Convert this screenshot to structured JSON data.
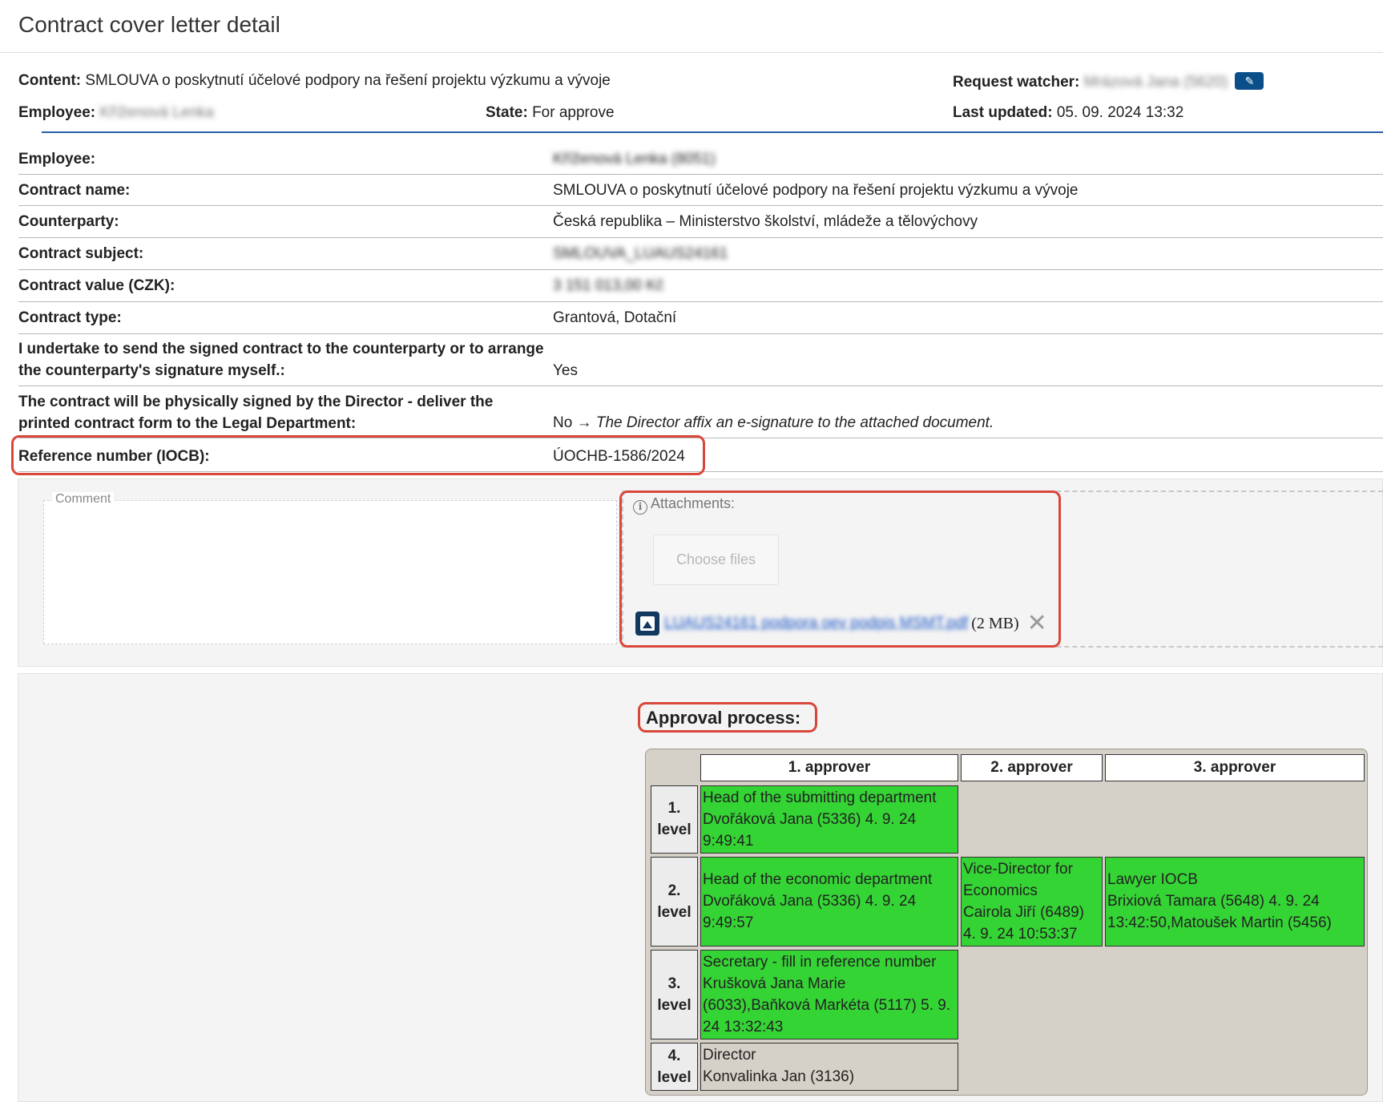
{
  "page": {
    "title": "Contract cover letter detail"
  },
  "summary": {
    "content_label": "Content:",
    "content_value": "SMLOUVA o poskytnutí účelové podpory na řešení projektu výzkumu a vývoje",
    "employee_label": "Employee:",
    "employee_value": "Kříženová Lenka",
    "state_label": "State:",
    "state_value": "For approve",
    "watcher_label": "Request watcher:",
    "watcher_value": "Mrázová Jana (5620)",
    "updated_label": "Last updated:",
    "updated_value": "05. 09. 2024 13:32"
  },
  "details": {
    "employee": {
      "label": "Employee:",
      "value": "Kříženová Lenka (8051)"
    },
    "contract_name": {
      "label": "Contract name:",
      "value": "SMLOUVA o poskytnutí účelové podpory na řešení projektu výzkumu a vývoje"
    },
    "counterparty": {
      "label": "Counterparty:",
      "value": "Česká republika – Ministerstvo školství, mládeže a tělovýchovy"
    },
    "subject": {
      "label": "Contract subject:",
      "value": "SMLOUVA_LUAUS24161"
    },
    "value": {
      "label": "Contract value (CZK):",
      "value": "3 151 013,00 Kč"
    },
    "type": {
      "label": "Contract type:",
      "value": "Grantová, Dotační"
    },
    "undertake": {
      "label": "I undertake to send the signed contract to the counterparty or to arrange the counterparty's signature myself.:",
      "value": "Yes"
    },
    "physical": {
      "label": "The contract will be physically signed by the Director - deliver the printed contract form to the Legal Department:",
      "value_prefix": "No →",
      "value_note": "The Director affix an e-signature to the attached document."
    },
    "reference": {
      "label": "Reference number (IOCB):",
      "value": "ÚOCHB-1586/2024"
    }
  },
  "comment": {
    "legend": "Comment"
  },
  "attachments": {
    "label": "Attachments:",
    "choose_label": "Choose files",
    "file_name": "LUAUS24161 podpora oev podpis MSMT.pdf",
    "file_size": "(2 MB)",
    "remove_glyph": "✕"
  },
  "approval": {
    "title": "Approval process:",
    "headers": [
      "1. approver",
      "2. approver",
      "3. approver"
    ],
    "levels": [
      {
        "num": "1.",
        "word": "level",
        "cells": [
          {
            "role": "Head of the submitting department",
            "who": "Dvořáková Jana (5336) 4. 9. 24 9:49:41"
          }
        ]
      },
      {
        "num": "2.",
        "word": "level",
        "cells": [
          {
            "role": "Head of the economic department",
            "who": "Dvořáková Jana (5336) 4. 9. 24 9:49:57"
          },
          {
            "role": "Vice-Director for Economics",
            "who": "Cairola Jiří (6489) 4. 9. 24 10:53:37"
          },
          {
            "role": "Lawyer IOCB",
            "who": "Brixiová Tamara (5648) 4. 9. 24 13:42:50,Matoušek Martin (5456)"
          }
        ]
      },
      {
        "num": "3.",
        "word": "level",
        "cells": [
          {
            "role": "Secretary - fill in reference number",
            "who": "Krušková Jana Marie (6033),Baňková Markéta (5117) 5. 9. 24 13:32:43"
          }
        ]
      },
      {
        "num": "4.",
        "word": "level",
        "cells": [
          {
            "role": "Director",
            "who": "Konvalinka Jan (3136)"
          }
        ]
      }
    ]
  },
  "colors": {
    "approved": "#35d435",
    "pending": "#d6d1c8",
    "highlight": "#d9473b",
    "accent": "#2a5ea8"
  },
  "icons": {
    "edit": "pencil-icon",
    "info": "info-icon",
    "file": "image-file-icon",
    "remove": "close-icon"
  }
}
